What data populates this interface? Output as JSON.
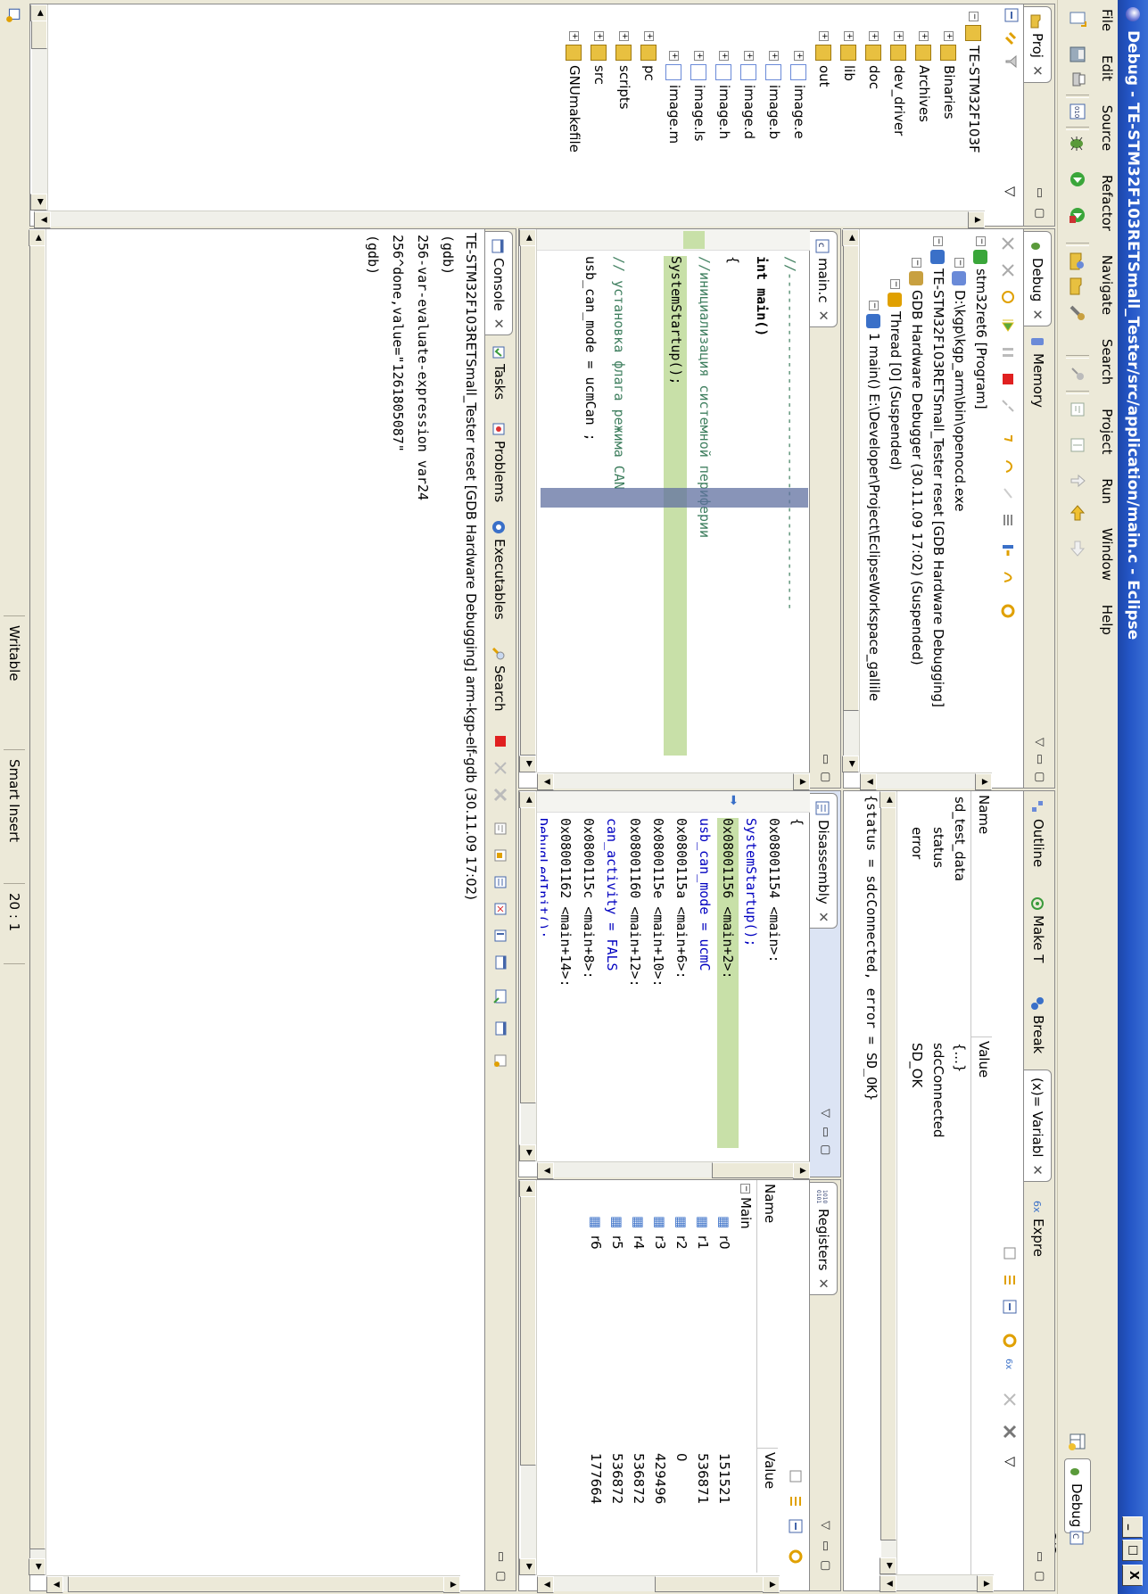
{
  "window": {
    "title": "Debug - TE-STM32F103RETSmall_Tester/src/application/main.c - Eclipse",
    "controls": [
      "_",
      "□",
      "X"
    ]
  },
  "menu": [
    "File",
    "Edit",
    "Source",
    "Refactor",
    "Navigate",
    "Search",
    "Project",
    "Run",
    "Window",
    "Help"
  ],
  "perspectives": {
    "debug": "Debug",
    "cpp": "C/C++"
  },
  "project_explorer": {
    "tab": "Proj",
    "items": [
      {
        "label": "TE-STM32F103F",
        "depth": 0
      },
      {
        "label": "Binaries",
        "depth": 1
      },
      {
        "label": "Archives",
        "depth": 1
      },
      {
        "label": "dev_driver",
        "depth": 1
      },
      {
        "label": "doc",
        "depth": 1
      },
      {
        "label": "lib",
        "depth": 1
      },
      {
        "label": "out",
        "depth": 1
      },
      {
        "label": "image.e",
        "depth": 2
      },
      {
        "label": "image.b",
        "depth": 2
      },
      {
        "label": "image.d",
        "depth": 2
      },
      {
        "label": "image.h",
        "depth": 2
      },
      {
        "label": "image.ls",
        "depth": 2
      },
      {
        "label": "image.m",
        "depth": 2
      },
      {
        "label": "pc",
        "depth": 1
      },
      {
        "label": "scripts",
        "depth": 1
      },
      {
        "label": "src",
        "depth": 1
      },
      {
        "label": "GNUmakefile",
        "depth": 1
      }
    ]
  },
  "debug_view": {
    "tabs": [
      "Debug",
      "Memory"
    ],
    "tree": [
      {
        "label": "stm32ret6 [Program]",
        "depth": 0
      },
      {
        "label": "D:\\kgp\\kgp_arm\\bin\\openocd.exe",
        "depth": 1
      },
      {
        "label": "TE-STM32F103RETSmall_Tester reset [GDB Hardware Debugging]",
        "depth": 0
      },
      {
        "label": "GDB Hardware Debugger (30.11.09 17:02) (Suspended)",
        "depth": 1
      },
      {
        "label": "Thread [0] (Suspended)",
        "depth": 2
      },
      {
        "label": "1 main() E:\\Developer\\Project\\EclipseWorkspace_gallile",
        "depth": 3
      },
      {
        "label": "arm-kgp-elf-gdb (30.11.09 17:02)",
        "depth": 1
      }
    ]
  },
  "variables_view": {
    "tabs": [
      "Outline",
      "Make T",
      "Break",
      "(x)= Variabl",
      "Expre"
    ],
    "columns": [
      "Name",
      "Value"
    ],
    "rows": [
      {
        "name": "sd_test_data",
        "value": "{...}"
      },
      {
        "name": "status",
        "value": "sdcConnected"
      },
      {
        "name": "error",
        "value": "SD_OK"
      }
    ],
    "detail": "{status = sdcConnected, error = SD_OK}"
  },
  "editor": {
    "tab": "main.c",
    "lines": [
      {
        "text": "//------------------------------------------",
        "kind": "comment"
      },
      {
        "text": "int main()",
        "kind": "sig"
      },
      {
        "text": "{",
        "kind": "code"
      },
      {
        "text": "    //инициализация системной периферии",
        "kind": "comment"
      },
      {
        "text": "    SystemStartup();",
        "kind": "current"
      },
      {
        "text": "",
        "kind": "code"
      },
      {
        "text": "    // установка флага режима  CAN",
        "kind": "comment"
      },
      {
        "text": "    usb_can_mode = ucmCan ;",
        "kind": "code"
      }
    ]
  },
  "disassembly": {
    "tab": "Disassembly",
    "lines": [
      {
        "text": "{",
        "kind": "plain"
      },
      {
        "text": "0x08001154 <main>:",
        "kind": "addr"
      },
      {
        "text": "    SystemStartup();",
        "kind": "src"
      },
      {
        "text": "0x08001156 <main+2>:",
        "kind": "current"
      },
      {
        "text": "    usb_can_mode = ucmC",
        "kind": "src"
      },
      {
        "text": "0x0800115a <main+6>:",
        "kind": "addr"
      },
      {
        "text": "0x0800115e <main+10>:",
        "kind": "addr"
      },
      {
        "text": "0x08001160 <main+12>:",
        "kind": "addr"
      },
      {
        "text": "    can_activity = FALS",
        "kind": "src"
      },
      {
        "text": "0x0800115c <main+8>:",
        "kind": "addr"
      },
      {
        "text": "0x08001162 <main+14>:",
        "kind": "addr"
      },
      {
        "text": "    DebugLedInit();",
        "kind": "src"
      },
      {
        "text": "0x08001164 <main+16>:",
        "kind": "addr"
      }
    ]
  },
  "registers": {
    "tab": "Registers",
    "columns": [
      "Name",
      "Value"
    ],
    "group": "Main",
    "rows": [
      {
        "name": "r0",
        "value": "151521"
      },
      {
        "name": "r1",
        "value": "536871"
      },
      {
        "name": "r2",
        "value": "0"
      },
      {
        "name": "r3",
        "value": "429496"
      },
      {
        "name": "r4",
        "value": "536872"
      },
      {
        "name": "r5",
        "value": "536872"
      },
      {
        "name": "r6",
        "value": "177664"
      }
    ]
  },
  "console": {
    "tabs": [
      "Console",
      "Tasks",
      "Problems",
      "Executables",
      "Search"
    ],
    "session": "TE-STM32F103RETSmall_Tester reset [GDB Hardware Debugging] arm-kgp-elf-gdb (30.11.09 17:02)",
    "lines": [
      "(gdb)",
      "256-var-evaluate-expression var24",
      "256^done,value=\"1261805087\"",
      "(gdb)"
    ]
  },
  "status_bar": {
    "writable": "Writable",
    "insert_mode": "Smart Insert",
    "position": "20 : 1"
  }
}
